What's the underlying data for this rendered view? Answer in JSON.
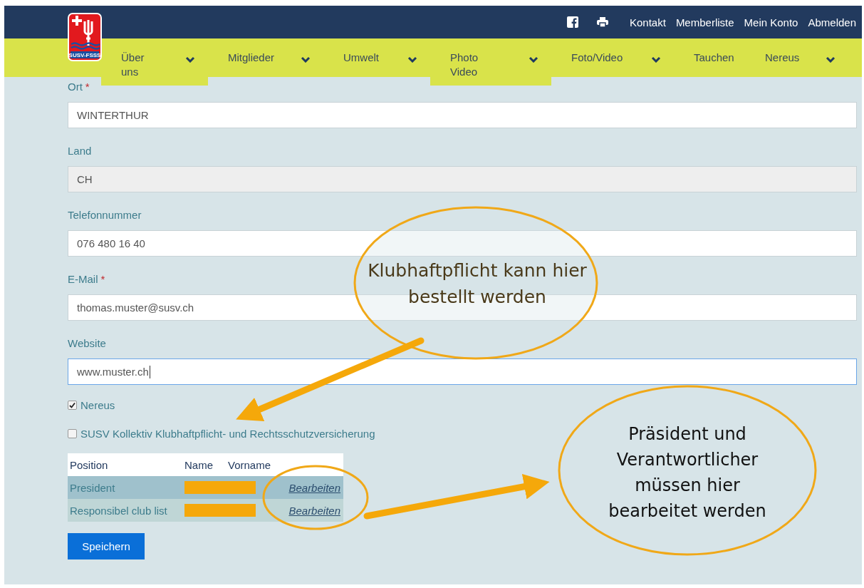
{
  "header": {
    "logo_text": "SUSV-FSSS",
    "top_links": [
      "Kontakt",
      "Memberliste",
      "Mein Konto",
      "Abmelden"
    ]
  },
  "nav": {
    "items": [
      {
        "label": "Über uns",
        "chevron": true
      },
      {
        "label": "Mitglieder",
        "chevron": true
      },
      {
        "label": "Umwelt",
        "chevron": true
      },
      {
        "label": "Photo Video",
        "chevron": true
      },
      {
        "label": "Foto/Video",
        "chevron": true
      },
      {
        "label": "Tauchen",
        "chevron": false
      },
      {
        "label": "Nereus",
        "chevron": true
      }
    ]
  },
  "form": {
    "fields": [
      {
        "label": "Ort",
        "required_mark": "*",
        "value": "WINTERTHUR",
        "disabled": false,
        "focused": false
      },
      {
        "label": "Land",
        "value": "CH",
        "disabled": true,
        "focused": false
      },
      {
        "label": "Telefonnummer",
        "value": "076 480 16 40",
        "disabled": false,
        "focused": false
      },
      {
        "label": "E-Mail",
        "required_mark": "*",
        "value": "thomas.muster@susv.ch",
        "disabled": false,
        "focused": false
      },
      {
        "label": "Website",
        "value": "www.muster.ch",
        "disabled": false,
        "focused": true
      }
    ],
    "checkboxes": [
      {
        "label": "Nereus",
        "checked": true
      },
      {
        "label": "SUSV Kollektiv Klubhaftpflicht- und Rechtsschutzversicherung",
        "checked": false
      }
    ],
    "table": {
      "columns": [
        "Position",
        "Name",
        "Vorname"
      ],
      "rows": [
        {
          "position": "President",
          "action": "Bearbeiten"
        },
        {
          "position": "Responsibel club list",
          "action": "Bearbeiten"
        }
      ]
    },
    "submit": "Speichern"
  },
  "annotations": [
    {
      "text": "Klubhaftpflicht kann hier bestellt werden"
    },
    {
      "text": "Präsident und Verantwortlicher müssen hier bearbeitet werden"
    }
  ]
}
